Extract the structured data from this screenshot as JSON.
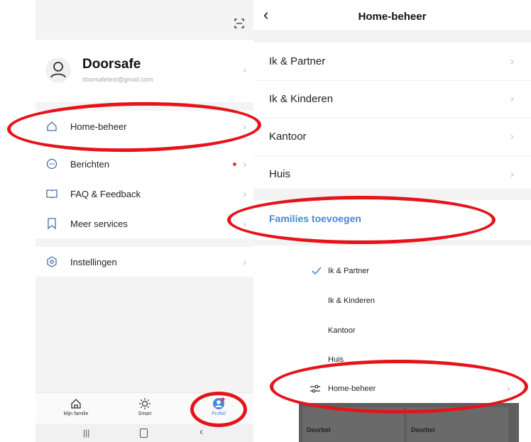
{
  "left": {
    "profile": {
      "name": "Doorsafe",
      "email": "doorsafetest@gmail.com"
    },
    "menu": [
      {
        "label": "Home-beheer",
        "icon": "home-icon"
      },
      {
        "label": "Berichten",
        "icon": "message-icon"
      },
      {
        "label": "FAQ & Feedback",
        "icon": "book-icon"
      },
      {
        "label": "Meer services",
        "icon": "bookmark-icon"
      },
      {
        "label": "Instellingen",
        "icon": "settings-icon"
      }
    ],
    "tabs": [
      {
        "label": "Mijn familie",
        "icon": "house-icon"
      },
      {
        "label": "Smart",
        "icon": "sun-icon"
      },
      {
        "label": "Profiel",
        "icon": "profile-icon"
      }
    ]
  },
  "right": {
    "title": "Home-beheer",
    "homes": [
      "Ik & Partner",
      "Ik & Kinderen",
      "Kantoor",
      "Huis"
    ],
    "add_label": "Families toevoegen",
    "popup": {
      "items": [
        "Ik & Partner",
        "Ik & Kinderen",
        "Kantoor",
        "Huis"
      ],
      "manage_label": "Home-beheer",
      "cards": [
        "Deurbel",
        "Deurbel"
      ]
    }
  },
  "colors": {
    "accent": "#4a86d9",
    "annotation": "#e5141b",
    "badge": "#e53935"
  }
}
